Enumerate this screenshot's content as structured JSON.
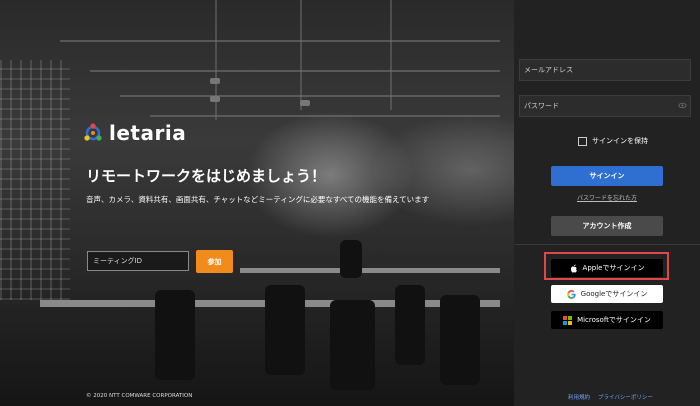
{
  "hero": {
    "logo_text": "letaria",
    "headline": "リモートワークをはじめましょう！",
    "subline": "音声、カメラ、資料共有、画面共有、チャットなどミーティングに必要なすべての機能を備えています",
    "meeting_id_placeholder": "ミーティングID",
    "join_label": "参加",
    "copyright": "© 2020 NTT COMWARE CORPORATION"
  },
  "login": {
    "email_placeholder": "メールアドレス",
    "password_placeholder": "パスワード",
    "remember_label": "サインインを保持",
    "signin_label": "サインイン",
    "forgot_label": "パスワードを忘れた方",
    "create_account_label": "アカウント作成"
  },
  "sso": {
    "apple_label": "Appleでサインイン",
    "google_label": "Googleでサインイン",
    "microsoft_label": "Microsoftでサインイン"
  },
  "footer": {
    "terms_label": "利用規約",
    "privacy_label": "プライバシーポリシー"
  },
  "colors": {
    "accent_orange": "#f08b1c",
    "primary_blue": "#2f6fd1",
    "highlight_red": "#e04848"
  }
}
